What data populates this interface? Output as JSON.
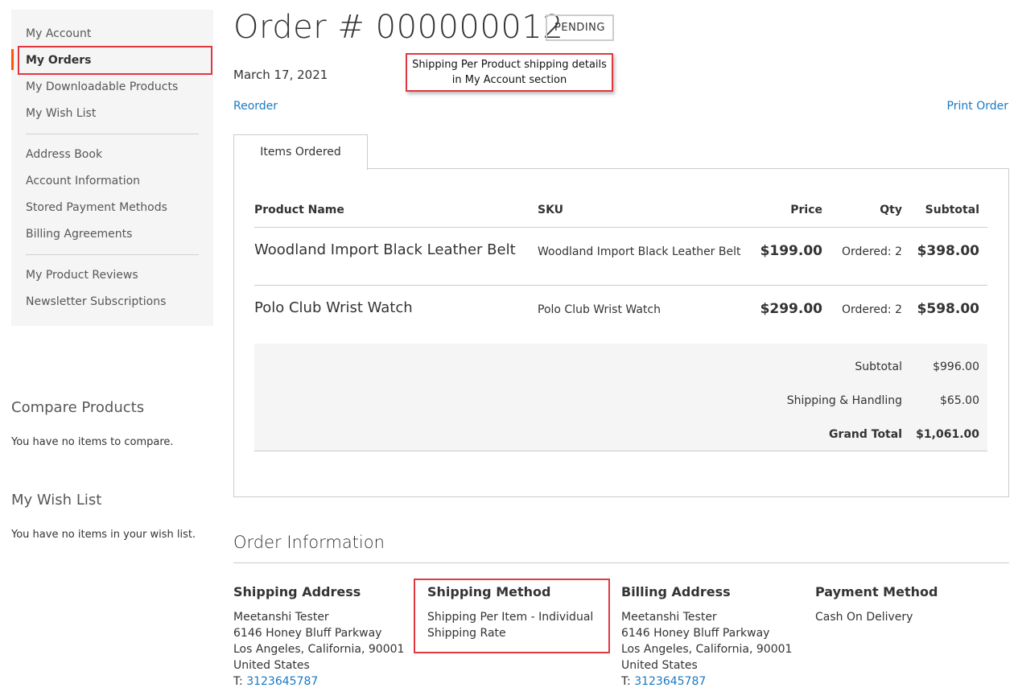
{
  "sidebar": {
    "nav_items": [
      {
        "label": "My Account"
      },
      {
        "label": "My Orders"
      },
      {
        "label": "My Downloadable Products"
      },
      {
        "label": "My Wish List"
      },
      {
        "label": "Address Book"
      },
      {
        "label": "Account Information"
      },
      {
        "label": "Stored Payment Methods"
      },
      {
        "label": "Billing Agreements"
      },
      {
        "label": "My Product Reviews"
      },
      {
        "label": "Newsletter Subscriptions"
      }
    ],
    "active_item": "My Orders",
    "compare": {
      "title": "Compare Products",
      "empty_text": "You have no items to compare."
    },
    "wishlist": {
      "title": "My Wish List",
      "empty_text": "You have no items in your wish list."
    }
  },
  "order": {
    "title": "Order # 000000012",
    "status": "PENDING",
    "date": "March 17, 2021",
    "reorder_label": "Reorder",
    "print_label": "Print Order"
  },
  "annotation": {
    "line1": "Shipping Per Product shipping details",
    "line2": "in My Account section"
  },
  "tabs": {
    "items_ordered": "Items Ordered"
  },
  "table": {
    "headers": {
      "name": "Product Name",
      "sku": "SKU",
      "price": "Price",
      "qty": "Qty",
      "subtotal": "Subtotal"
    },
    "rows": [
      {
        "name": "Woodland Import Black Leather Belt",
        "sku": "Woodland Import Black Leather Belt",
        "price": "$199.00",
        "qty": "Ordered: 2",
        "subtotal": "$398.00"
      },
      {
        "name": "Polo Club Wrist Watch",
        "sku": "Polo Club Wrist Watch",
        "price": "$299.00",
        "qty": "Ordered: 2",
        "subtotal": "$598.00"
      }
    ]
  },
  "totals": {
    "subtotal_label": "Subtotal",
    "subtotal_value": "$996.00",
    "shipping_label": "Shipping & Handling",
    "shipping_value": "$65.00",
    "grand_label": "Grand Total",
    "grand_value": "$1,061.00"
  },
  "order_info": {
    "title": "Order Information",
    "shipping_address": {
      "title": "Shipping Address",
      "name": "Meetanshi Tester",
      "street": "6146 Honey Bluff Parkway",
      "city": "Los Angeles, California, 90001",
      "country": "United States",
      "phone_prefix": "T: ",
      "phone": "3123645787"
    },
    "shipping_method": {
      "title": "Shipping Method",
      "line1": "Shipping Per Item - Individual",
      "line2": "Shipping Rate"
    },
    "billing_address": {
      "title": "Billing Address",
      "name": "Meetanshi Tester",
      "street": "6146 Honey Bluff Parkway",
      "city": "Los Angeles, California, 90001",
      "country": "United States",
      "phone_prefix": "T: ",
      "phone": "3123645787"
    },
    "payment_method": {
      "title": "Payment Method",
      "value": "Cash On Delivery"
    }
  },
  "colors": {
    "link": "#1979c3",
    "highlight_border": "#e0383e",
    "active_nav_bar": "#ff5501",
    "sidebar_bg": "#f5f5f5"
  }
}
